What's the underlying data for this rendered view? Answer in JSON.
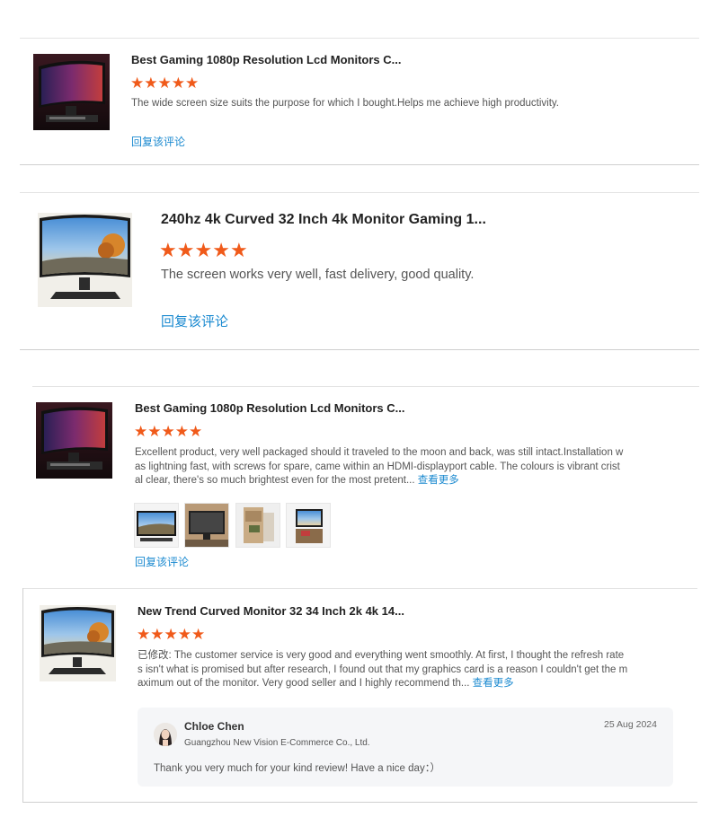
{
  "colors": {
    "star": "#f05a1a",
    "link": "#1b8ad0",
    "text": "#555555",
    "title": "#222222"
  },
  "reviews": [
    {
      "product_title": "Best Gaming 1080p Resolution Lcd Monitors C...",
      "rating": 5,
      "text": "The wide screen size suits the purpose for which I bought.Helps me achieve high productivity.",
      "reply_label": "回复该评论"
    },
    {
      "product_title": "240hz 4k Curved 32 Inch 4k Monitor Gaming 1...",
      "rating": 5,
      "text": "The screen works very well, fast delivery, good quality.",
      "reply_label": "回复该评论"
    },
    {
      "product_title": "Best Gaming 1080p Resolution Lcd Monitors C...",
      "rating": 5,
      "text_lines": [
        "Excellent product, very well packaged should it traveled to the moon and back, was still intact.Installation w",
        "as lightning fast, with screws for spare, came within an HDMI-displayport cable. The colours is vibrant crist",
        "al clear, there's so much brightest even for the most pretent..."
      ],
      "more_label": "查看更多",
      "photos": [
        "photo-1",
        "photo-2",
        "photo-3",
        "photo-4"
      ],
      "reply_label": "回复该评论"
    },
    {
      "product_title": "New Trend Curved Monitor 32 34 Inch 2k 4k 14...",
      "rating": 5,
      "text_lines": [
        "已修改: The customer service is very good and everything went smoothly. At first, I thought the refresh rate",
        "s isn't what is promised but after research, I found out that my graphics card is a reason I couldn't get the m",
        "aximum out of the monitor. Very good seller and I highly recommend th..."
      ],
      "more_label": "查看更多",
      "seller_reply": {
        "name": "Chloe Chen",
        "company": "Guangzhou New Vision E-Commerce Co., Ltd.",
        "date": "25 Aug 2024",
        "message": "Thank you very much for your kind review! Have a nice day：）"
      }
    }
  ]
}
